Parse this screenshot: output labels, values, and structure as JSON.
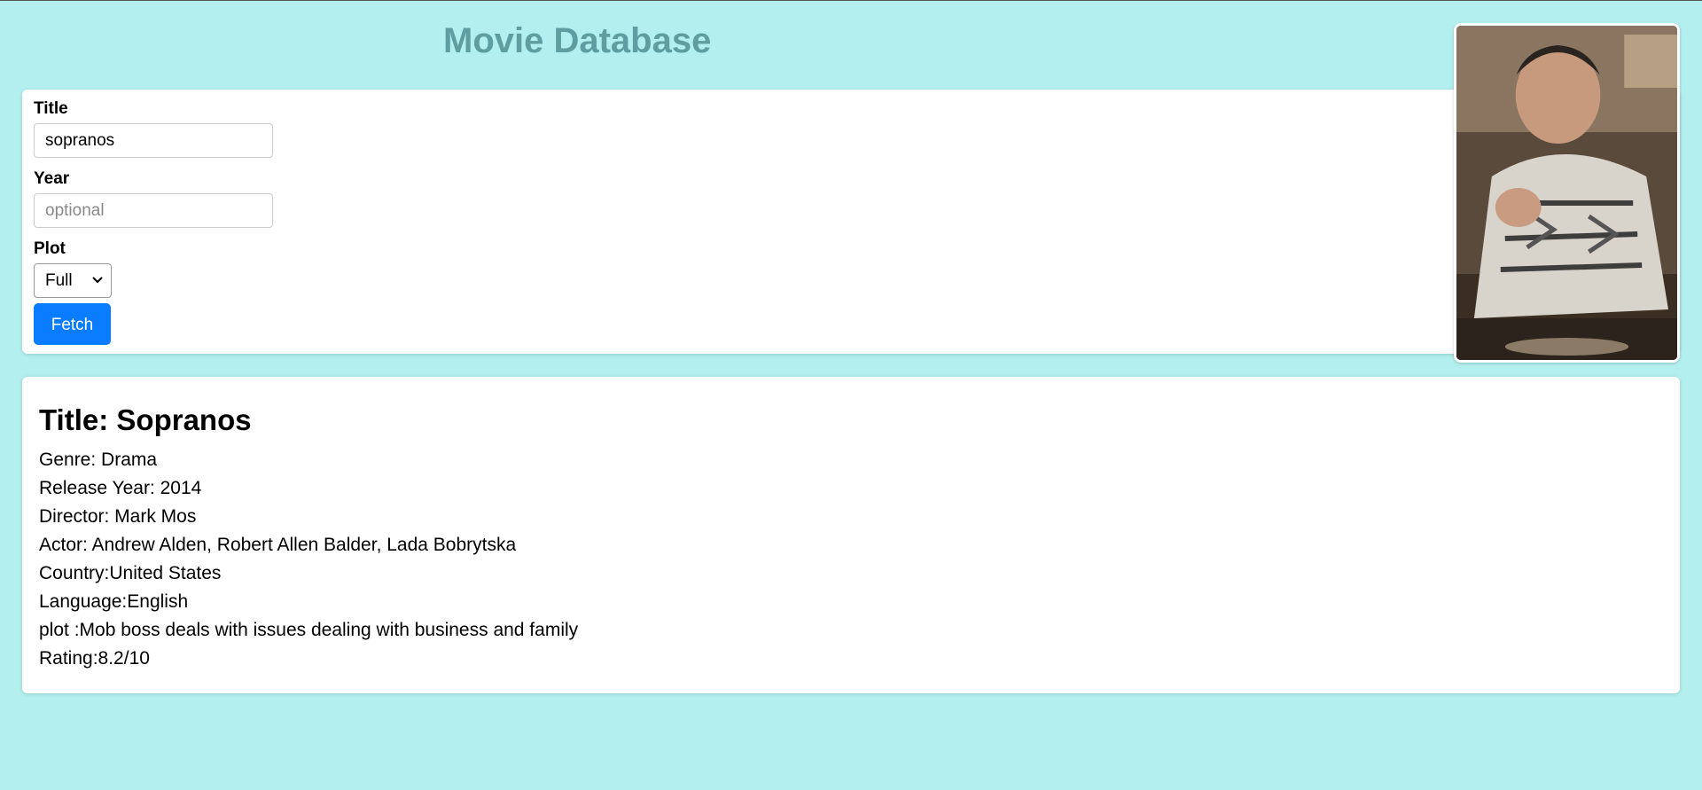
{
  "header": {
    "title": "Movie Database"
  },
  "form": {
    "title_label": "Title",
    "title_value": "sopranos",
    "year_label": "Year",
    "year_placeholder": "optional",
    "plot_label": "Plot",
    "plot_selected": "Full",
    "fetch_label": "Fetch"
  },
  "poster": {
    "icon": "poster-image"
  },
  "result": {
    "title": "Title: Sopranos",
    "genre": "Genre: Drama",
    "release_year": "Release Year: 2014",
    "director": "Director: Mark Mos",
    "actors": "Actor: Andrew Alden, Robert Allen Balder, Lada Bobrytska",
    "country": "Country:United States",
    "language": "Language:English",
    "plot": "plot :Mob boss deals with issues dealing with business and family",
    "rating": "Rating:8.2/10"
  },
  "colors": {
    "background": "#b2efee",
    "title": "#5f9ea0",
    "button": "#0a7cff"
  }
}
